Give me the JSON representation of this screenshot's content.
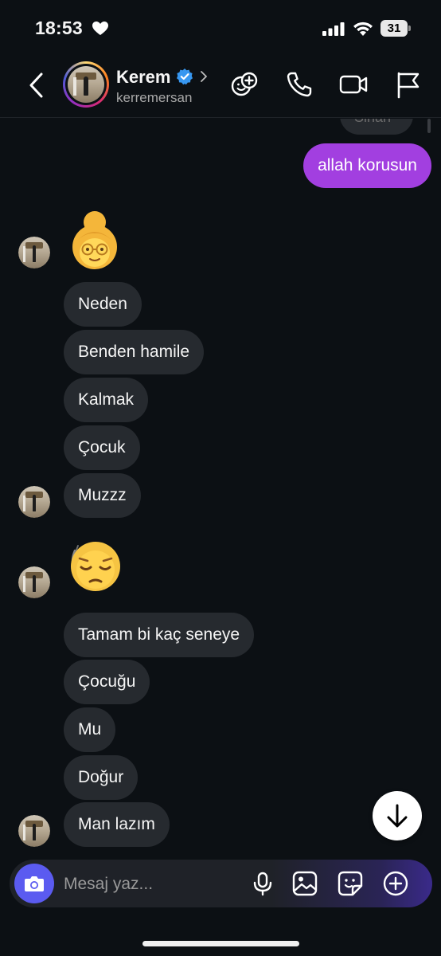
{
  "status_bar": {
    "time": "18:53",
    "battery": "31"
  },
  "header": {
    "name": "Kerem",
    "username": "kerremersan"
  },
  "chat": {
    "partial_message": "Sinan",
    "outgoing": [
      {
        "text": "allah korusun"
      }
    ],
    "incoming": [
      {
        "text": "Neden"
      },
      {
        "text": "Benden hamile"
      },
      {
        "text": "Kalmak"
      },
      {
        "text": "Çocuk"
      },
      {
        "text": "Muzzz"
      },
      {
        "text": "Tamam bi kaç seneye"
      },
      {
        "text": "Çocuğu"
      },
      {
        "text": "Mu"
      },
      {
        "text": "Doğur"
      },
      {
        "text": "Man lazım"
      }
    ],
    "emojis": [
      "👵",
      "😔"
    ]
  },
  "composer": {
    "placeholder": "Mesaj yaz..."
  },
  "colors": {
    "outgoing_bubble": "#a23fe0",
    "incoming_bubble": "#262a2f",
    "background": "#0c1014",
    "verified": "#3797f0"
  }
}
